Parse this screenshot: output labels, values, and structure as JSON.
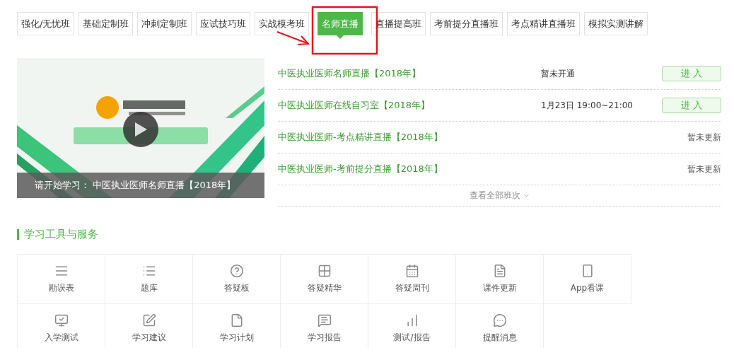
{
  "tabs": [
    {
      "label": "强化/无忧班",
      "selected": false
    },
    {
      "label": "基础定制班",
      "selected": false
    },
    {
      "label": "冲刺定制班",
      "selected": false
    },
    {
      "label": "应试技巧班",
      "selected": false
    },
    {
      "label": "实战模考班",
      "selected": false
    },
    {
      "label": "名师直播",
      "selected": true
    },
    {
      "label": "直播提高班",
      "selected": false
    },
    {
      "label": "考前提分直播班",
      "selected": false
    },
    {
      "label": "考点精讲直播班",
      "selected": false
    },
    {
      "label": "模拟实测讲解",
      "selected": false
    }
  ],
  "video": {
    "kind": "picture",
    "caption": "请开始学习： 中医执业医师名师直播【2018年】"
  },
  "courses": [
    {
      "title": "中医执业医师名师直播【2018年】",
      "info": "暂未开通",
      "action": {
        "kind": "button",
        "label": "进 入"
      }
    },
    {
      "title": "中医执业医师在线自习室【2018年】",
      "info": "1月23日 19:00~21:00",
      "action": {
        "kind": "button",
        "label": "进 入"
      }
    },
    {
      "title": "中医执业医师-考点精讲直播【2018年】",
      "action": {
        "kind": "note",
        "label": "暂未更新"
      }
    },
    {
      "title": "中医执业医师-考前提分直播【2018年】",
      "action": {
        "kind": "note",
        "label": "暂未更新"
      }
    }
  ],
  "view_all": "查看全部班次",
  "tools_section": {
    "title": "学习工具与服务",
    "items": [
      {
        "label": "勘误表"
      },
      {
        "label": "题库"
      },
      {
        "label": "答疑板"
      },
      {
        "label": "答疑精华"
      },
      {
        "label": "答疑周刊"
      },
      {
        "label": "课件更新"
      },
      {
        "label": "App看课"
      },
      {
        "label": "入学测试"
      },
      {
        "label": "学习建议"
      },
      {
        "label": "学习计划"
      },
      {
        "label": "学习报告"
      },
      {
        "label": "测试/报告"
      },
      {
        "label": "提醒消息"
      }
    ]
  }
}
